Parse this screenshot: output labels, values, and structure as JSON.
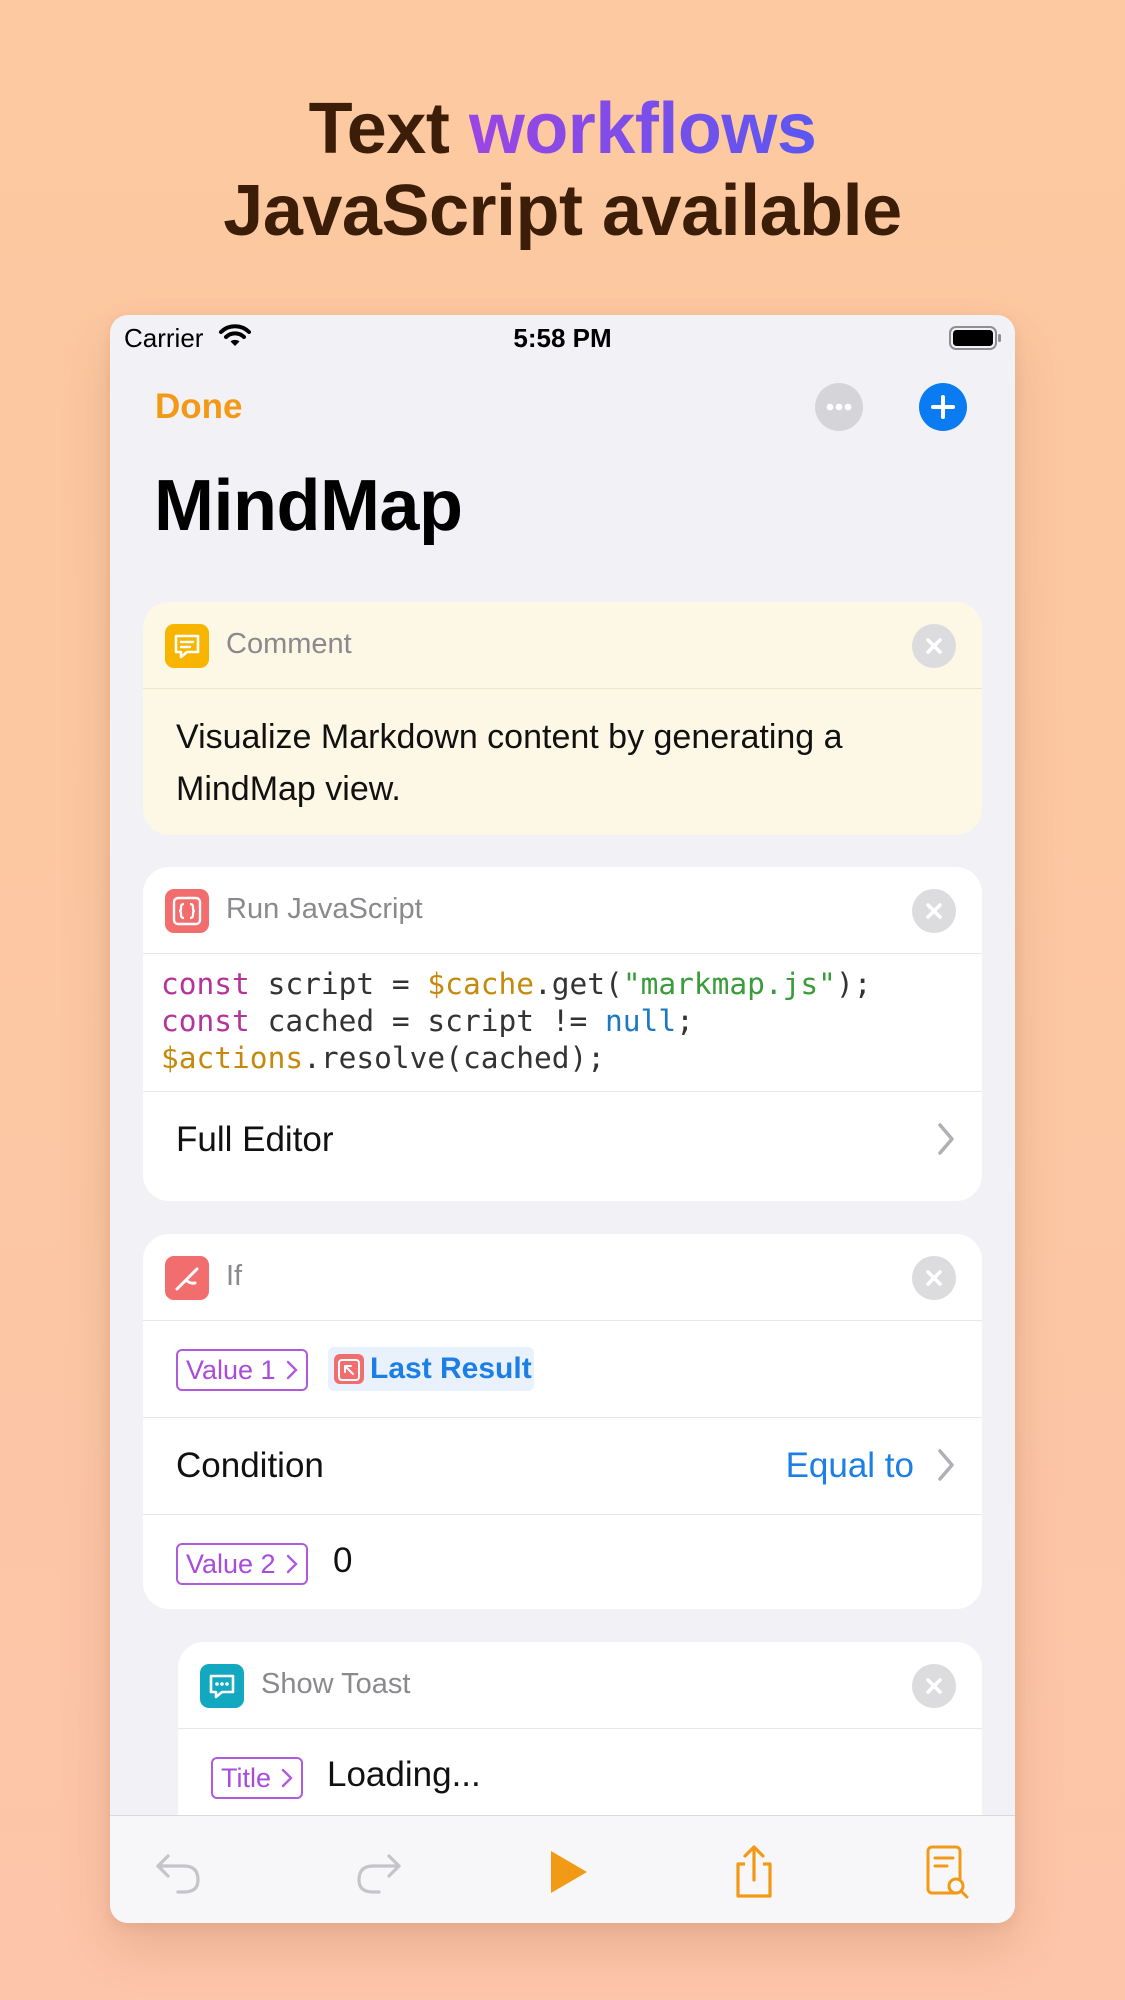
{
  "headline": {
    "line1_prefix": "Text ",
    "line1_accent": "workflows",
    "line2": "JavaScript available"
  },
  "status_bar": {
    "carrier": "Carrier",
    "time": "5:58 PM"
  },
  "navbar": {
    "done_label": "Done",
    "title": "MindMap"
  },
  "actions": {
    "comment": {
      "title": "Comment",
      "text": "Visualize Markdown content by generating a MindMap view."
    },
    "run_js": {
      "title": "Run JavaScript",
      "code": {
        "l1_kw": "const",
        "l1_id": " script = ",
        "l1_var": "$cache",
        "l1_call": ".get(",
        "l1_str": "\"markmap.js\"",
        "l1_end": ");",
        "l2_kw": "const",
        "l2_id": " cached = script != ",
        "l2_null": "null",
        "l2_end": ";",
        "l3_var": "$actions",
        "l3_rest": ".resolve(cached);"
      },
      "full_editor_label": "Full Editor"
    },
    "if": {
      "title": "If",
      "value1_label": "Value 1",
      "value1_token": "Last Result",
      "condition_label": "Condition",
      "condition_value": "Equal to",
      "value2_label": "Value 2",
      "value2_value": "0"
    },
    "show_toast": {
      "title": "Show Toast",
      "title_label": "Title",
      "title_value": "Loading..."
    }
  },
  "colors": {
    "accent_orange": "#f29a16",
    "accent_blue": "#0b7bf2",
    "comment_icon": "#f7b500",
    "js_icon": "#f26e6e",
    "if_icon": "#f26e6e",
    "toast_icon": "#12a8c0",
    "token_purple": "#a94bdd"
  },
  "icons": {
    "done": "done-button",
    "more": "ellipsis-icon",
    "add": "plus-icon",
    "comment": "chat-bubble-icon",
    "js": "braces-icon",
    "if": "branch-icon",
    "toast": "message-icon",
    "undo": "undo-icon",
    "redo": "redo-icon",
    "run": "play-icon",
    "share": "share-icon",
    "log": "document-search-icon"
  }
}
